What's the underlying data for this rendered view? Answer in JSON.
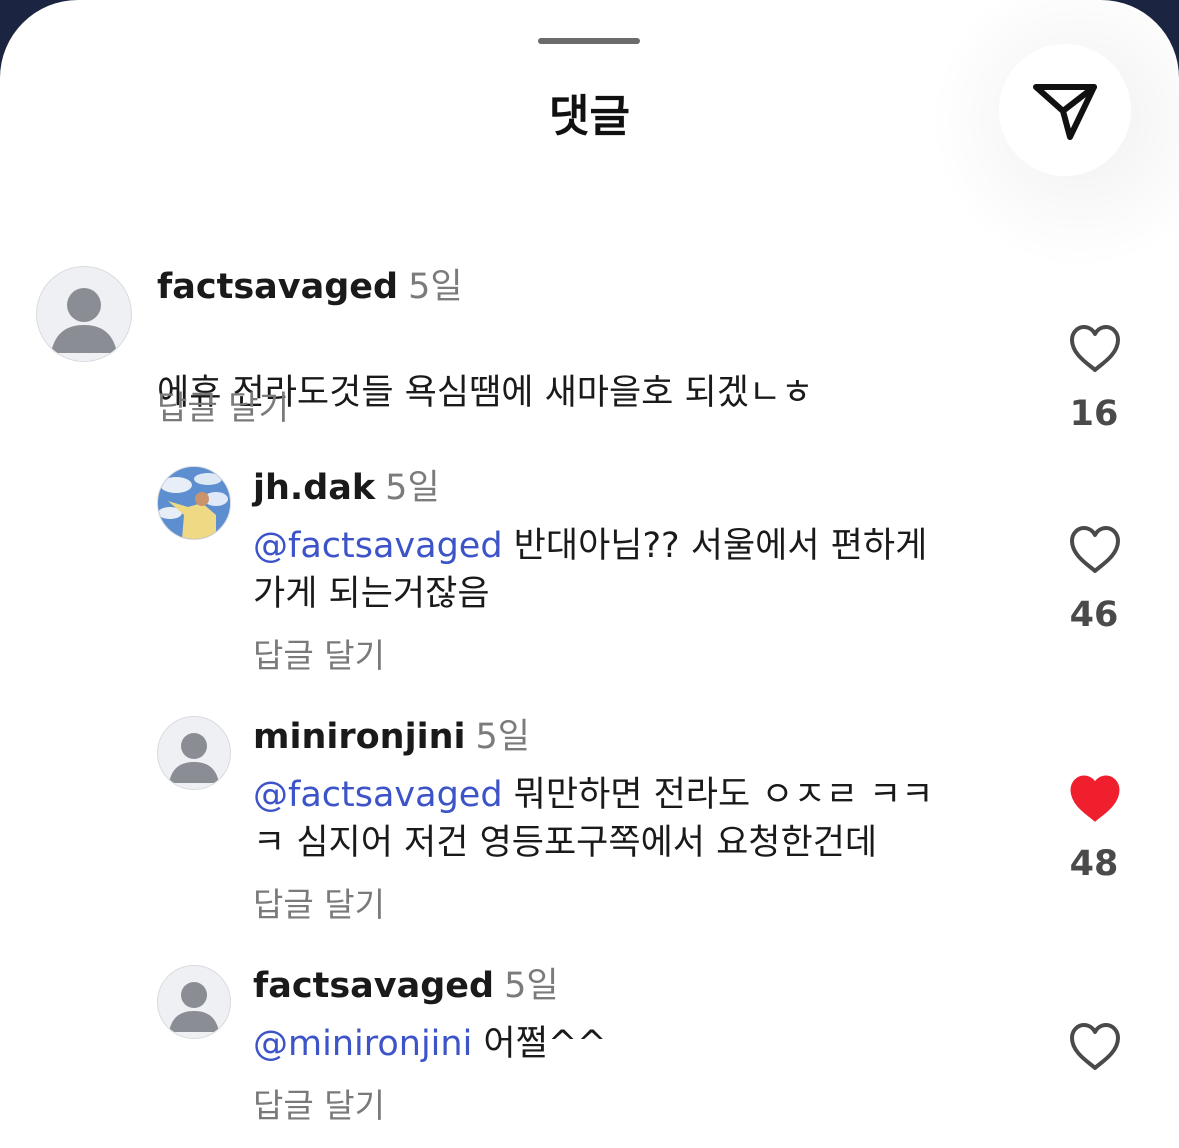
{
  "sheet": {
    "title": "댓글"
  },
  "colors": {
    "mention": "#3d54c9",
    "liked_heart": "#ef1f2e",
    "heart_outline": "#4a4a4a"
  },
  "comments": [
    {
      "username": "factsavaged",
      "time": "5일",
      "mention": "",
      "text": "에휴 전라도것들 욕심땜에 새마을호 되겠ㄴㅎ",
      "reply_label": "답글 달기",
      "likes": "16",
      "liked": false,
      "avatar": "default-avatar-icon"
    },
    {
      "username": "jh.dak",
      "time": "5일",
      "mention": "@factsavaged",
      "text": " 반대아님?? 서울에서 편하게\n가게 되는거잖음",
      "reply_label": "답글 달기",
      "likes": "46",
      "liked": false,
      "avatar": "photo-avatar"
    },
    {
      "username": "minironjini",
      "time": "5일",
      "mention": "@factsavaged",
      "text": " 뭐만하면 전라도 ㅇㅈㄹ ㅋㅋ\nㅋ 심지어 저건 영등포구쪽에서 요청한건데",
      "reply_label": "답글 달기",
      "likes": "48",
      "liked": true,
      "avatar": "default-avatar-icon"
    },
    {
      "username": "factsavaged",
      "time": "5일",
      "mention": "@minironjini",
      "text": " 어쩔^^",
      "reply_label": "답글 달기",
      "likes": "",
      "liked": false,
      "avatar": "default-avatar-icon"
    }
  ]
}
